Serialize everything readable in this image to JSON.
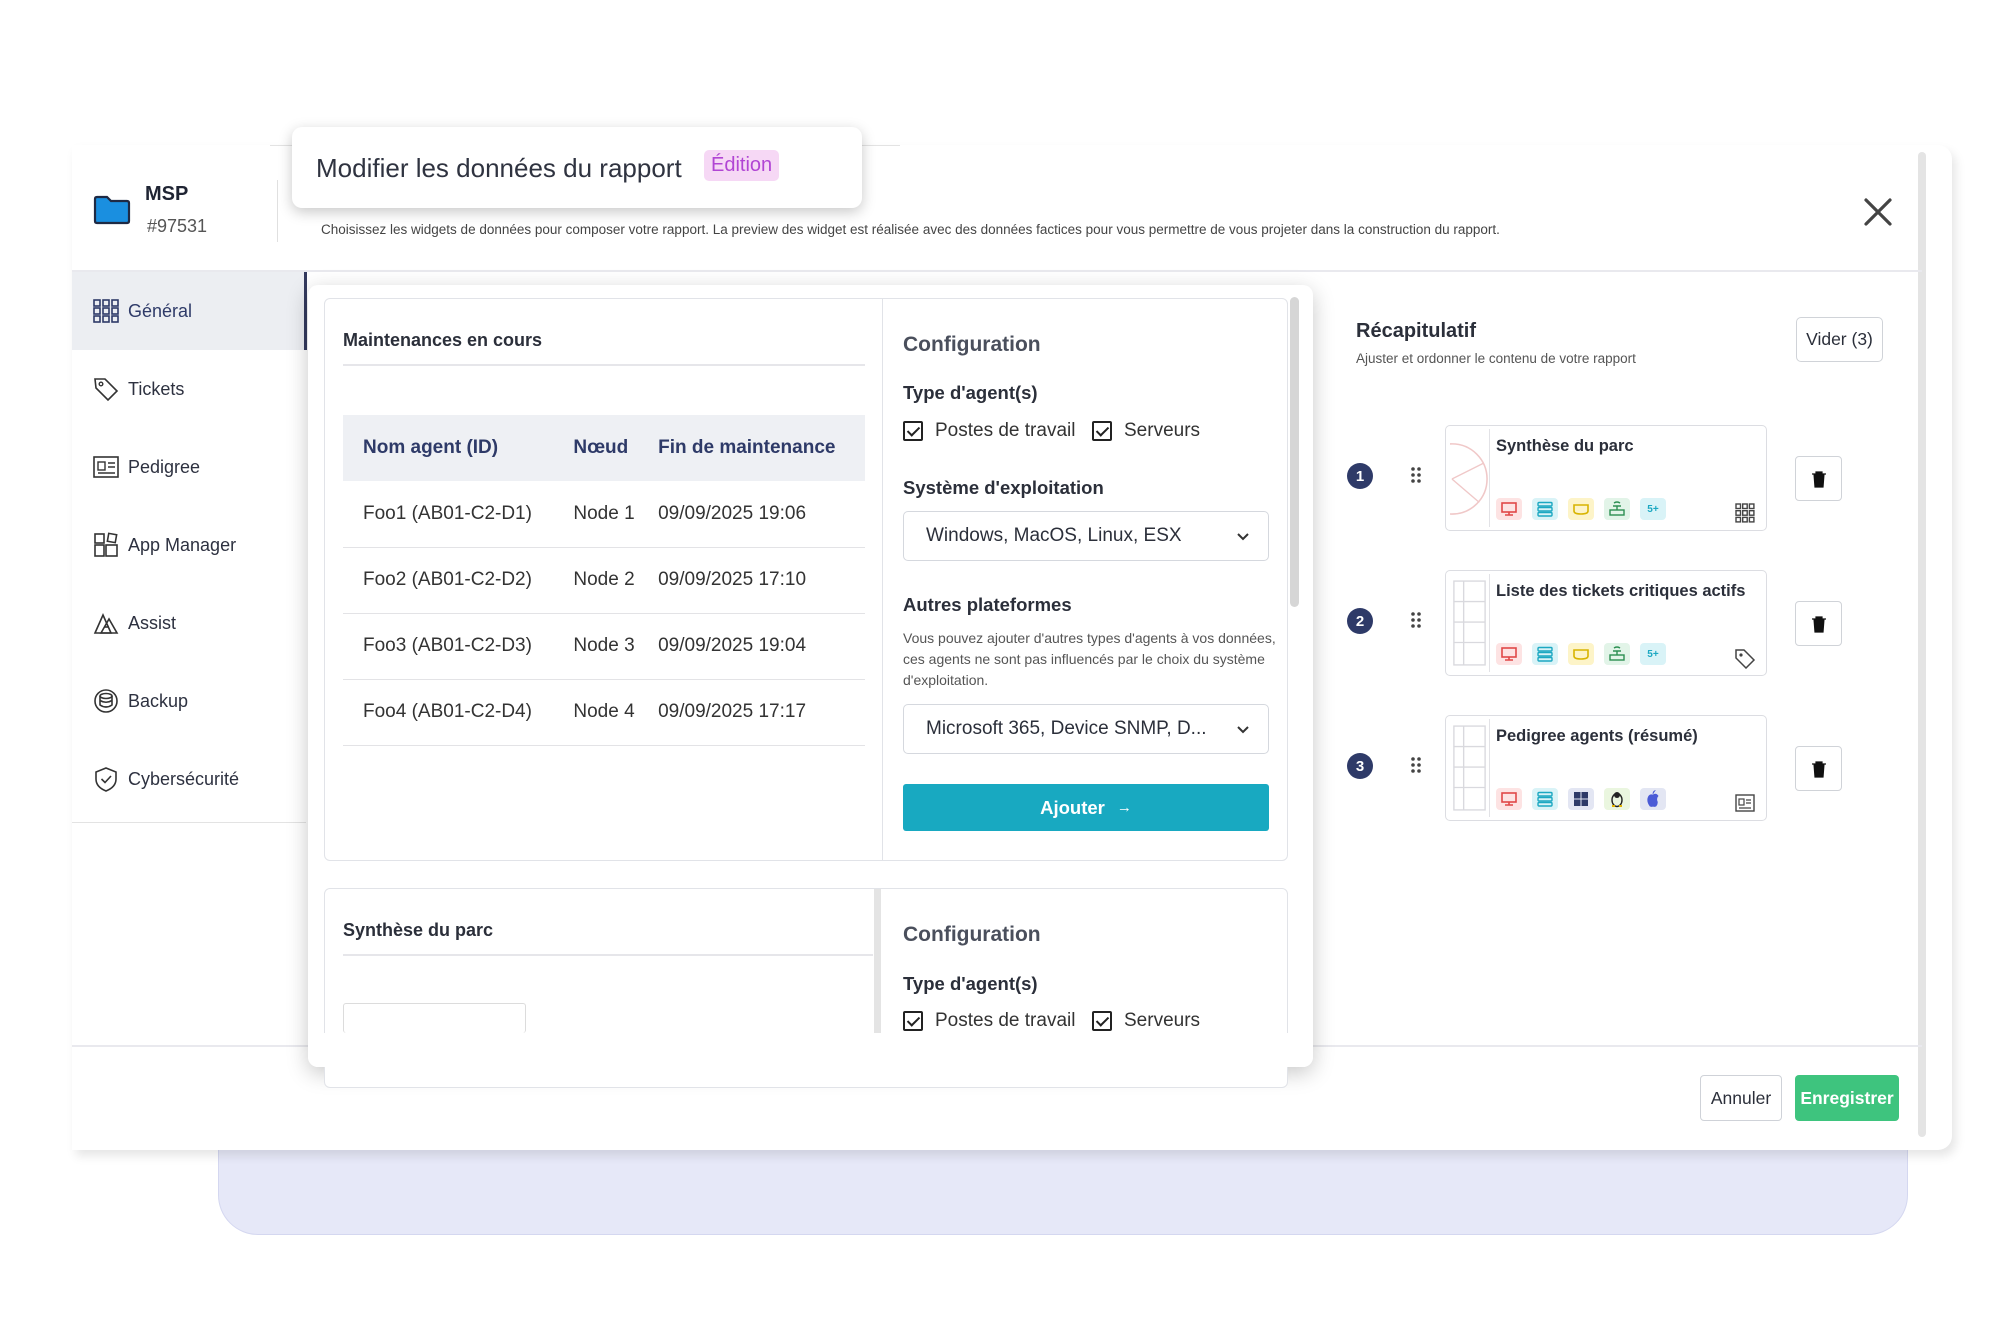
{
  "title_popup": {
    "title": "Modifier les données du rapport",
    "badge": "Édition"
  },
  "project": {
    "name": "MSP",
    "id": "#97531"
  },
  "subtitle": "Choisissez les widgets de données pour composer votre rapport. La preview des widget est réalisée avec des données factices pour vous permettre de vous projeter dans la construction du rapport.",
  "sidebar": {
    "items": [
      {
        "label": "Général",
        "icon": "grid-icon",
        "active": true
      },
      {
        "label": "Tickets",
        "icon": "tag-icon"
      },
      {
        "label": "Pedigree",
        "icon": "id-card-icon"
      },
      {
        "label": "App Manager",
        "icon": "apps-icon"
      },
      {
        "label": "Assist",
        "icon": "assist-icon"
      },
      {
        "label": "Backup",
        "icon": "backup-icon"
      },
      {
        "label": "Cybersécurité",
        "icon": "shield-icon"
      }
    ]
  },
  "widget1": {
    "title": "Maintenances en cours",
    "columns": [
      "Nom agent (ID)",
      "Nœud",
      "Fin de maintenance"
    ],
    "rows": [
      [
        "Foo1 (AB01-C2-D1)",
        "Node 1",
        "09/09/2025 19:06"
      ],
      [
        "Foo2 (AB01-C2-D2)",
        "Node 2",
        "09/09/2025 17:10"
      ],
      [
        "Foo3 (AB01-C2-D3)",
        "Node 3",
        "09/09/2025 19:04"
      ],
      [
        "Foo4 (AB01-C2-D4)",
        "Node 4",
        "09/09/2025 17:17"
      ]
    ],
    "config": {
      "heading": "Configuration",
      "agent_type_label": "Type d'agent(s)",
      "agent_types": [
        {
          "label": "Postes de travail",
          "checked": true
        },
        {
          "label": "Serveurs",
          "checked": true
        }
      ],
      "os_label": "Système d'exploitation",
      "os_value": "Windows, MacOS, Linux, ESX",
      "other_label": "Autres plateformes",
      "other_note": "Vous pouvez ajouter d'autres types d'agents à vos données, ces agents ne sont pas influencés par le choix du système d'exploitation.",
      "other_value": "Microsoft 365, Device SNMP, D...",
      "add_button": "Ajouter",
      "add_arrow": "→"
    }
  },
  "widget2": {
    "title": "Synthèse du parc",
    "config": {
      "heading": "Configuration",
      "agent_type_label": "Type d'agent(s)",
      "agent_types": [
        {
          "label": "Postes de travail",
          "checked": true
        },
        {
          "label": "Serveurs",
          "checked": true
        }
      ]
    }
  },
  "recap": {
    "title": "Récapitulatif",
    "subtitle": "Ajuster et ordonner le contenu de votre rapport",
    "clear_button": "Vider (3)",
    "items": [
      {
        "num": "1",
        "title": "Synthèse du parc",
        "badge": "5+",
        "corner_icon": "grid-icon"
      },
      {
        "num": "2",
        "title": "Liste des tickets critiques actifs",
        "badge": "5+",
        "corner_icon": "tag-icon"
      },
      {
        "num": "3",
        "title": "Pedigree agents (résumé)",
        "corner_icon": "id-card-icon"
      }
    ]
  },
  "footer": {
    "cancel": "Annuler",
    "save": "Enregistrer"
  },
  "colors": {
    "accent": "#18a9c1",
    "save": "#3ec47e",
    "navy": "#2e3a68",
    "badge_bg": "#f6d8f5",
    "badge_text": "#b145d4"
  }
}
